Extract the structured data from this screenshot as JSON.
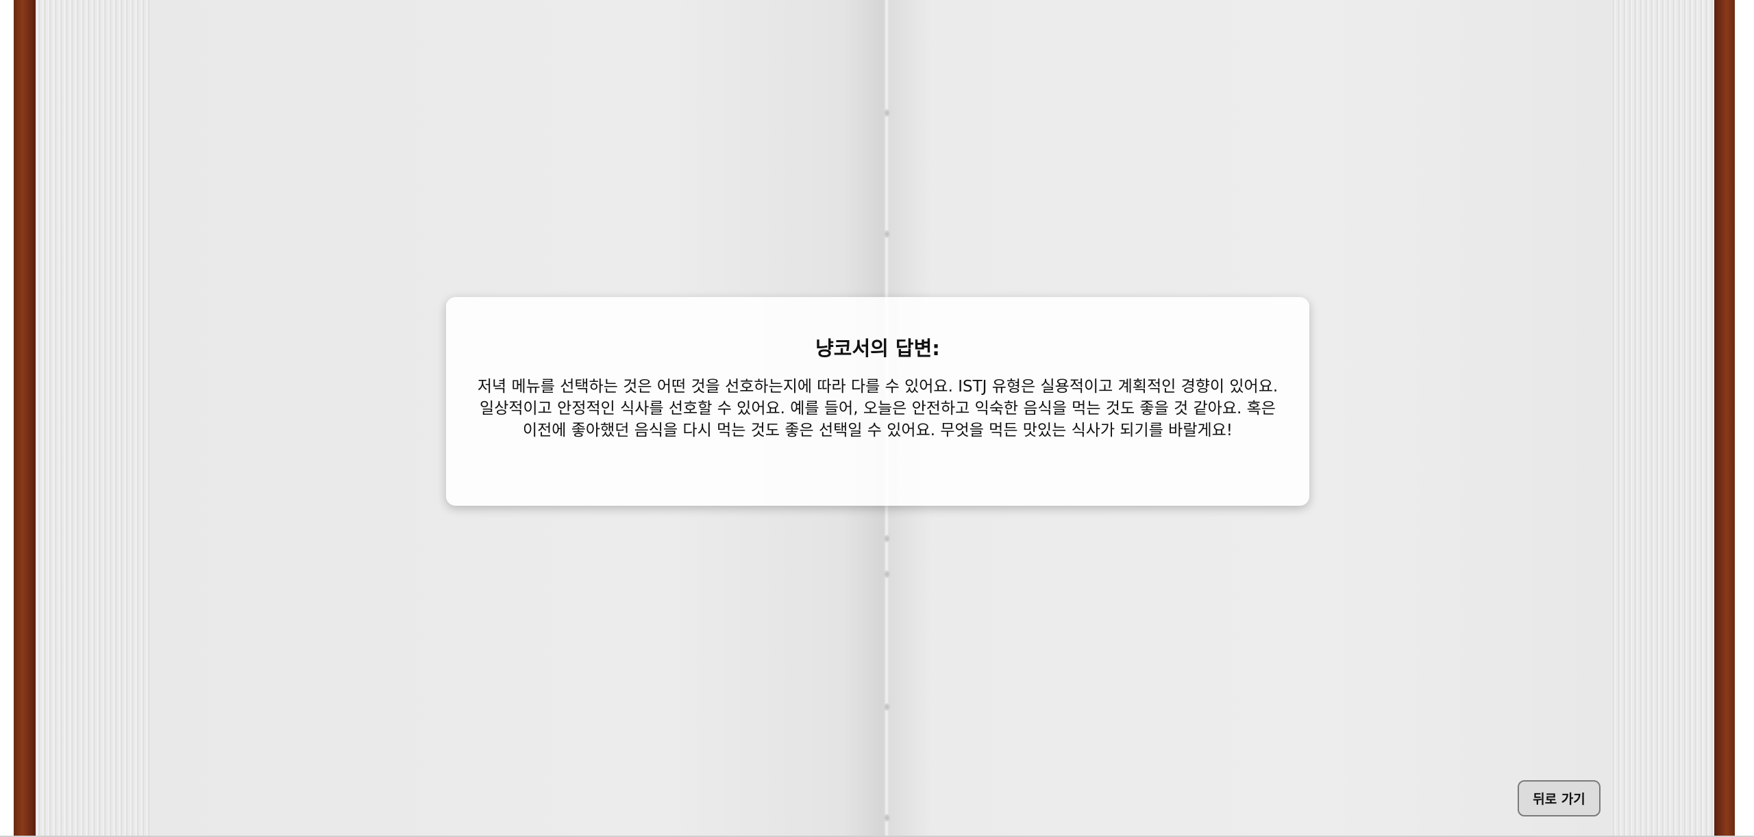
{
  "answer": {
    "title": "냥코서의 답변:",
    "body": "저녁 메뉴를 선택하는 것은 어떤 것을 선호하는지에 따라 다를 수 있어요. ISTJ 유형은 실용적이고 계획적인 경향이 있어요. 일상적이고 안정적인 식사를 선호할 수 있어요. 예를 들어, 오늘은 안전하고 익숙한 음식을 먹는 것도 좋을 것 같아요. 혹은 이전에 좋아했던 음식을 다시 먹는 것도 좋은 선택일 수 있어요. 무엇을 먹든 맛있는 식사가 되기를 바랄게요!"
  },
  "back_button": {
    "label": "뒤로 가기"
  },
  "colors": {
    "cover": "#8a3a1a",
    "page": "#ececec",
    "card": "#ffffff",
    "button": "#dcdcdc"
  }
}
